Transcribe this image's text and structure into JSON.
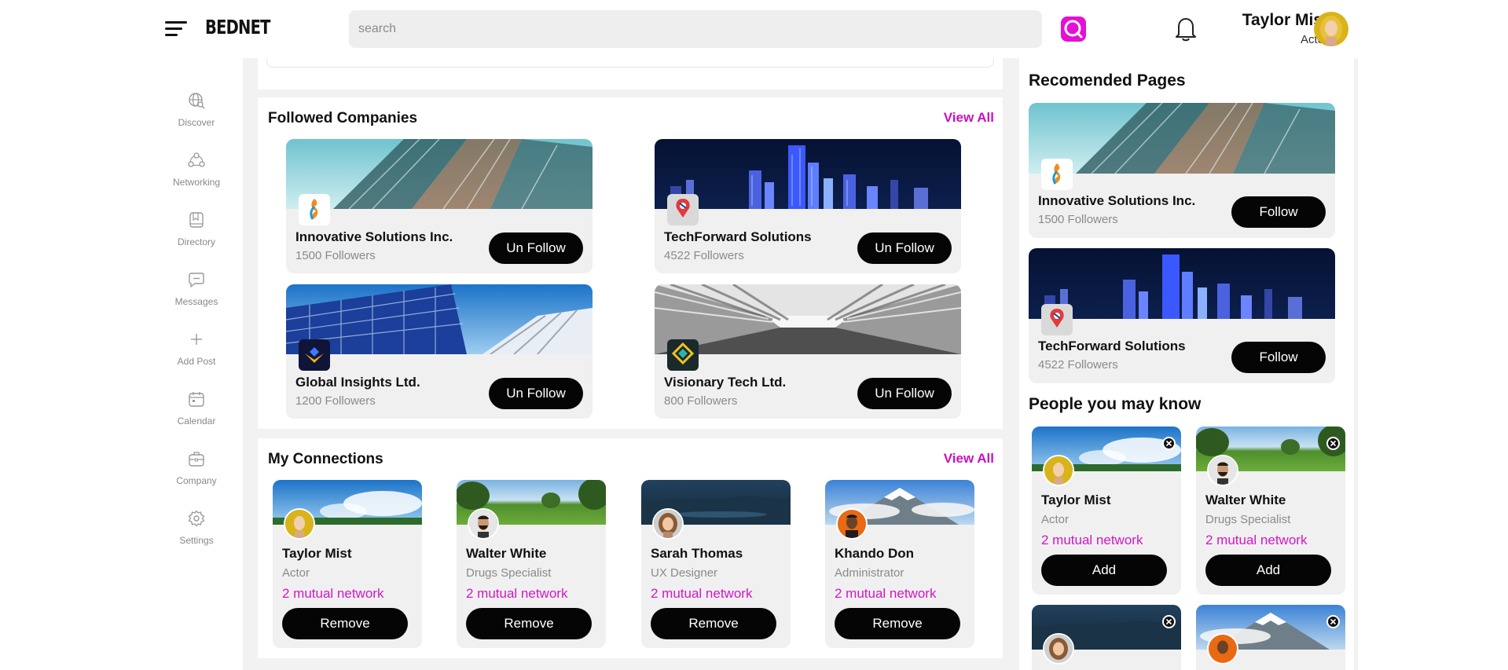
{
  "app": {
    "logo": "BEDNET"
  },
  "header": {
    "search": {
      "placeholder": "search"
    },
    "user": {
      "name": "Taylor Mist",
      "role": "Actor"
    }
  },
  "sidebar": {
    "items": [
      {
        "label": "Discover",
        "icon": "globe-search-icon"
      },
      {
        "label": "Networking",
        "icon": "network-icon"
      },
      {
        "label": "Directory",
        "icon": "book-icon"
      },
      {
        "label": "Messages",
        "icon": "message-icon"
      },
      {
        "label": "Add Post",
        "icon": "plus-icon"
      },
      {
        "label": "Calendar",
        "icon": "calendar-icon"
      },
      {
        "label": "Company",
        "icon": "briefcase-icon"
      },
      {
        "label": "Settings",
        "icon": "gear-icon"
      }
    ]
  },
  "followed_companies": {
    "title": "Followed Companies",
    "view_all": "View All",
    "items": [
      {
        "name": "Innovative Solutions Inc.",
        "followers": "1500 Followers",
        "action": "Un Follow"
      },
      {
        "name": "TechForward Solutions",
        "followers": "4522 Followers",
        "action": "Un Follow"
      },
      {
        "name": "Global Insights Ltd.",
        "followers": "1200 Followers",
        "action": "Un Follow"
      },
      {
        "name": "Visionary Tech Ltd.",
        "followers": "800 Followers",
        "action": "Un Follow"
      }
    ]
  },
  "connections": {
    "title": "My Connections",
    "view_all": "View All",
    "items": [
      {
        "name": "Taylor Mist",
        "role": "Actor",
        "mutual": "2 mutual network",
        "action": "Remove"
      },
      {
        "name": "Walter White",
        "role": "Drugs Specialist",
        "mutual": "2 mutual network",
        "action": "Remove"
      },
      {
        "name": "Sarah Thomas",
        "role": "UX Designer",
        "mutual": "2 mutual network",
        "action": "Remove"
      },
      {
        "name": "Khando Don",
        "role": "Administrator",
        "mutual": "2 mutual network",
        "action": "Remove"
      }
    ]
  },
  "recommended_pages": {
    "title": "Recomended Pages",
    "items": [
      {
        "name": "Innovative Solutions Inc.",
        "followers": "1500 Followers",
        "action": "Follow"
      },
      {
        "name": "TechForward Solutions",
        "followers": "4522 Followers",
        "action": "Follow"
      }
    ]
  },
  "people_you_may_know": {
    "title": "People you may know",
    "items": [
      {
        "name": "Taylor Mist",
        "role": "Actor",
        "mutual": "2 mutual network",
        "action": "Add"
      },
      {
        "name": "Walter White",
        "role": "Drugs Specialist",
        "mutual": "2 mutual network",
        "action": "Add"
      }
    ]
  },
  "colors": {
    "accent": "#e50fd6",
    "link": "#c910c0",
    "button": "#050505",
    "background": "#f2f2f2"
  }
}
